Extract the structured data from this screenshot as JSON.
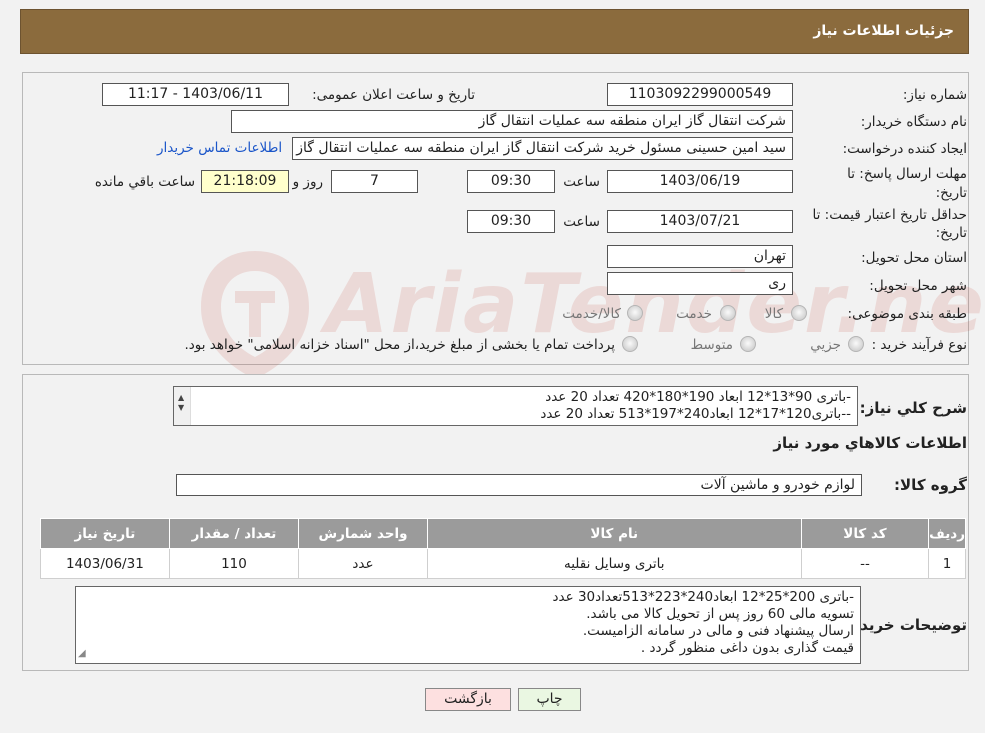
{
  "header": {
    "title": "جزئیات اطلاعات نیاز"
  },
  "form": {
    "need_number_label": "شماره نیاز:",
    "need_number": "1103092299000549",
    "announce_label": "تاریخ و ساعت اعلان عمومی:",
    "announce_value": "1403/06/11 - 11:17",
    "buyer_org_label": "نام دستگاه خریدار:",
    "buyer_org": "شرکت انتقال گاز ایران منطقه سه عملیات انتقال گاز",
    "creator_label": "ایجاد کننده درخواست:",
    "creator": "سید امین حسینی مسئول خرید شرکت انتقال گاز ایران منطقه سه عملیات انتقال گاز",
    "contact_link": "اطلاعات تماس خریدار",
    "deadline_label_1": "مهلت ارسال پاسخ: تا",
    "deadline_label_2": "تاریخ:",
    "deadline_date": "1403/06/19",
    "time_label": "ساعت",
    "deadline_time": "09:30",
    "days_value": "7",
    "days_label": "روز و",
    "remaining_time": "21:18:09",
    "remaining_label": "ساعت باقي مانده",
    "validity_label_1": "حداقل تاریخ اعتبار قیمت: تا",
    "validity_label_2": "تاریخ:",
    "validity_date": "1403/07/21",
    "validity_time": "09:30",
    "province_label": "استان محل تحویل:",
    "province": "تهران",
    "city_label": "شهر محل تحویل:",
    "city": "ری",
    "category_label": "طبقه بندی موضوعی:",
    "category_options": [
      "کالا",
      "خدمت",
      "کالا/خدمت"
    ],
    "process_label": "نوع فرآیند خرید :",
    "process_options": [
      "جزیي",
      "متوسط"
    ],
    "process_note": "پرداخت تمام یا بخشی از مبلغ خرید،از محل \"اسناد خزانه اسلامی\" خواهد بود."
  },
  "summary": {
    "label": "شرح کلي نياز:",
    "lines": [
      "-باتری 90*13*12  ابعاد  190*180*420  تعداد 20 عدد",
      "--باتری120*17*12  ابعاد240*197*513  تعداد 20 عدد"
    ]
  },
  "goods_section": {
    "title": "اطلاعات کالاهاي مورد نياز",
    "group_label": "گروه کالا:",
    "group_value": "لوازم خودرو و ماشین آلات"
  },
  "table": {
    "headers": [
      "ردیف",
      "کد کالا",
      "نام کالا",
      "واحد شمارش",
      "تعداد / مقدار",
      "تاریخ نیاز"
    ],
    "rows": [
      [
        "1",
        "--",
        "باتری وسایل نقلیه",
        "عدد",
        "110",
        "1403/06/31"
      ]
    ]
  },
  "buyer_notes": {
    "label": "توضیحات خریدار:",
    "lines": [
      "-باتری 200*25*12 ابعاد240*223*513تعداد30 عدد",
      "تسویه مالی 60 روز پس از تحویل کالا می باشد.",
      "ارسال پیشنهاد فنی و مالی در سامانه الزامیست.",
      "قیمت گذاری بدون داغی منظور گردد ."
    ]
  },
  "buttons": {
    "print": "چاپ",
    "back": "بازگشت"
  },
  "watermark": {
    "text": "AriaTender.neT"
  },
  "colors": {
    "header_bg": "#8b6b3d",
    "link": "#1a55c9",
    "back_btn_bg": "#fde0e0",
    "print_btn_bg": "#eaf7e2"
  }
}
